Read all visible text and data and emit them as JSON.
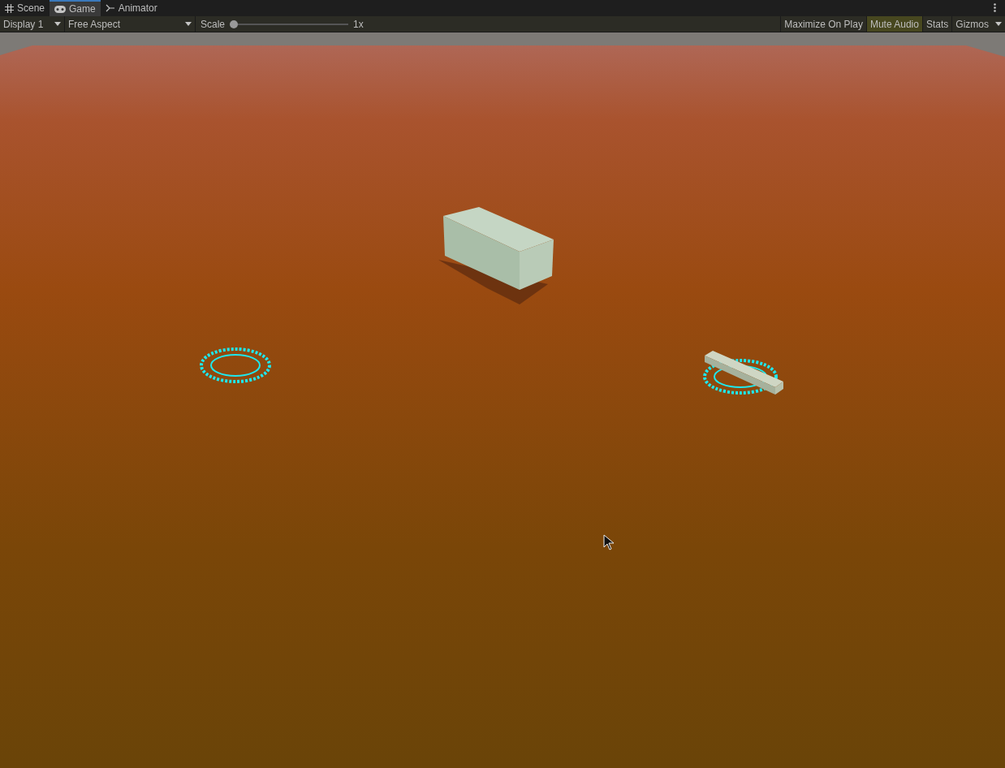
{
  "tabs": [
    {
      "kind": "grid",
      "label": "Scene",
      "selected": false
    },
    {
      "kind": "gamepad",
      "label": "Game",
      "selected": true
    },
    {
      "kind": "animator",
      "label": "Animator",
      "selected": false
    }
  ],
  "toolbar": {
    "display": "Display 1",
    "aspect": "Free Aspect",
    "scale": {
      "label": "Scale",
      "level": 0,
      "reading": "1x"
    },
    "toggles": [
      {
        "label": "Maximize On Play",
        "on": false
      },
      {
        "label": "Mute Audio",
        "on": true
      },
      {
        "label": "Stats",
        "on": false
      }
    ],
    "gizmos": "Gizmos"
  }
}
